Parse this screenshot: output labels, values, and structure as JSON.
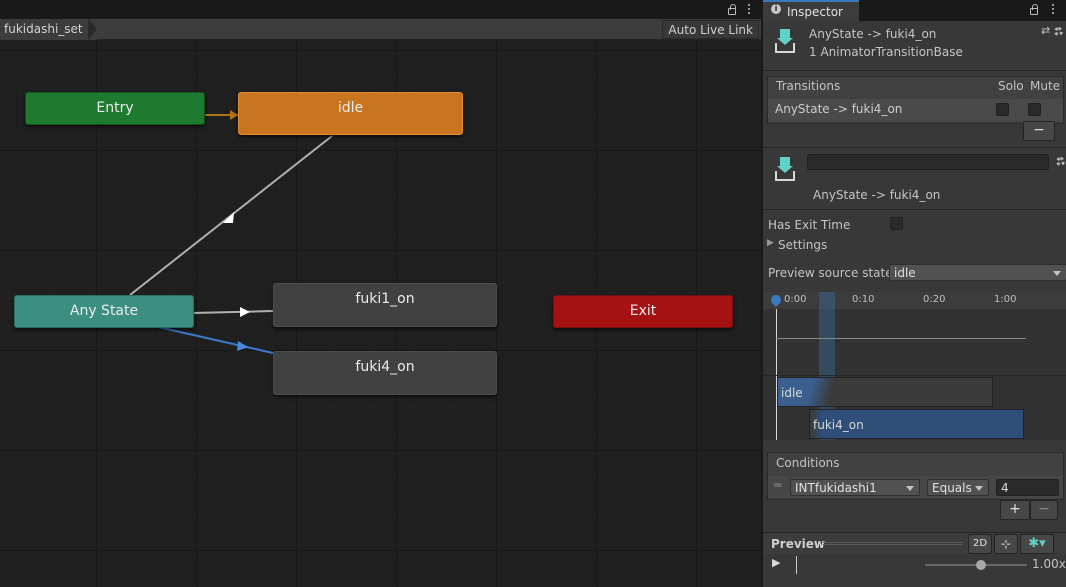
{
  "animator": {
    "breadcrumb": "fukidashi_set",
    "auto_live_link": "Auto Live Link",
    "nodes": {
      "entry": "Entry",
      "idle": "idle",
      "any_state": "Any State",
      "fuki1_on": "fuki1_on",
      "fuki4_on": "fuki4_on",
      "exit": "Exit"
    },
    "colors": {
      "entry": "#1d7a2f",
      "idle": "#c9741f",
      "any_state": "#3a8f81",
      "state": "#414141",
      "exit": "#a61212",
      "selected_transition": "#3c78c8",
      "entry_transition": "#b46f19"
    }
  },
  "inspector": {
    "tab": "Inspector",
    "header_title": "AnyState -> fuki4_on",
    "header_subtitle": "1 AnimatorTransitionBase",
    "transitions": {
      "header": "Transitions",
      "solo_label": "Solo",
      "mute_label": "Mute",
      "rows": [
        {
          "name": "AnyState -> fuki4_on",
          "solo": false,
          "mute": false
        }
      ],
      "remove_label": "−"
    },
    "transition_name_value": "",
    "transition_label": "AnyState -> fuki4_on",
    "has_exit_time_label": "Has Exit Time",
    "has_exit_time": false,
    "settings_label": "Settings",
    "preview_source_label": "Preview source state",
    "preview_source_value": "idle",
    "timeline": {
      "ticks": [
        "0:00",
        "0:10",
        "0:20",
        "1:00"
      ],
      "source_bar": "idle",
      "dest_bar": "fuki4_on"
    },
    "conditions": {
      "header": "Conditions",
      "parameter": "INTfukidashi1",
      "operator": "Equals",
      "value": "4",
      "add_label": "+",
      "remove_label": "−"
    },
    "preview": {
      "label": "Preview",
      "mode_2d": "2D",
      "speed": "1.00x",
      "speed_level": 0.55
    }
  }
}
